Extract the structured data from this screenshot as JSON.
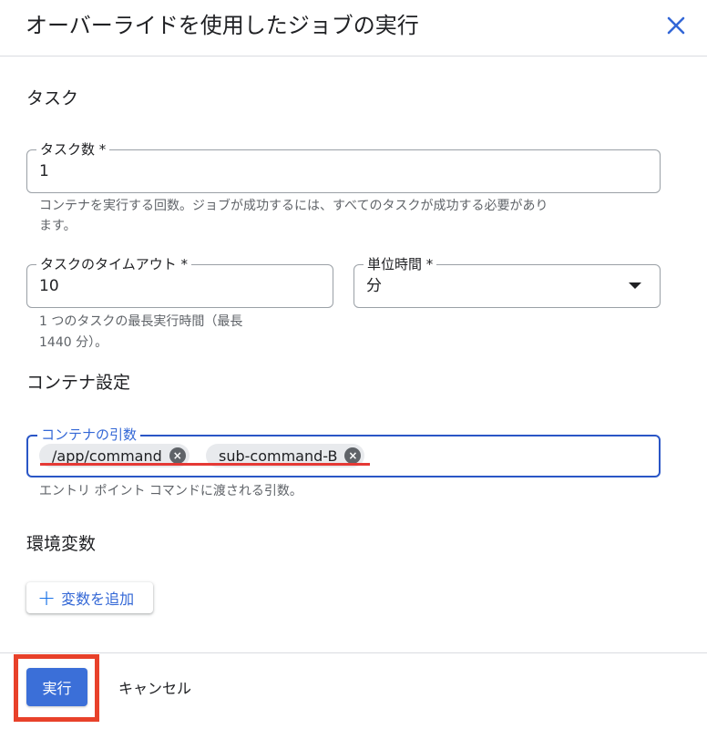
{
  "header": {
    "title": "オーバーライドを使用したジョブの実行",
    "close_icon": "close-icon"
  },
  "tasks_section": {
    "title": "タスク",
    "task_count": {
      "label": "タスク数 *",
      "value": "1",
      "helper_line1": "コンテナを実行する回数。ジョブが成功するには、すべてのタスクが成功する必要があり",
      "helper_line2": "ます。"
    },
    "task_timeout": {
      "label": "タスクのタイムアウト *",
      "value": "10",
      "helper_line1": "1 つのタスクの最長実行時間（最長",
      "helper_line2": "1440 分）。"
    },
    "time_unit": {
      "label": "単位時間 *",
      "value": "分"
    }
  },
  "container_section": {
    "title": "コンテナ設定",
    "args": {
      "label": "コンテナの引数",
      "chips": [
        "/app/command",
        "sub-command-B"
      ],
      "helper": "エントリ ポイント コマンドに渡される引数。"
    }
  },
  "env_section": {
    "title": "環境変数",
    "add_button_label": "変数を追加"
  },
  "footer": {
    "run_label": "実行",
    "cancel_label": "キャンセル"
  },
  "colors": {
    "accent": "#3367d6",
    "primary_button": "#3b6fd8",
    "highlight": "#e8412a",
    "underline": "#e53935"
  }
}
